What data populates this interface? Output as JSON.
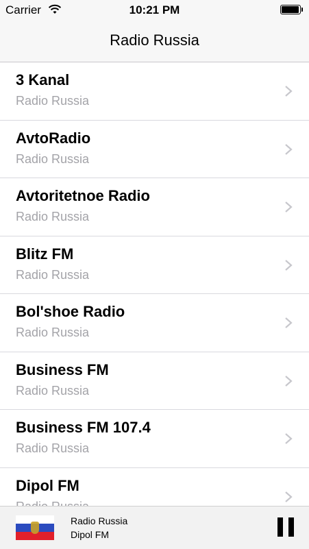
{
  "status_bar": {
    "carrier": "Carrier",
    "time": "10:21 PM",
    "icons": [
      "wifi-icon",
      "battery-icon"
    ]
  },
  "nav": {
    "title": "Radio Russia"
  },
  "stations": [
    {
      "name": "3 Kanal",
      "subtitle": "Radio Russia"
    },
    {
      "name": "AvtoRadio",
      "subtitle": "Radio Russia"
    },
    {
      "name": "Avtoritetnoe Radio",
      "subtitle": "Radio Russia"
    },
    {
      "name": "Blitz FM",
      "subtitle": "Radio Russia"
    },
    {
      "name": "Bol'shoe Radio",
      "subtitle": "Radio Russia"
    },
    {
      "name": "Business FM",
      "subtitle": "Radio Russia"
    },
    {
      "name": "Business FM 107.4",
      "subtitle": "Radio Russia"
    },
    {
      "name": "Dipol FM",
      "subtitle": "Radio Russia"
    }
  ],
  "player": {
    "line1": "Radio Russia",
    "line2": "Dipol FM",
    "flag_icon": "russia-flag-icon",
    "control_icon": "pause-icon"
  },
  "colors": {
    "subtitle": "#a3a3a8",
    "bar_background": "#f7f7f7",
    "separator": "#d9d9de"
  }
}
